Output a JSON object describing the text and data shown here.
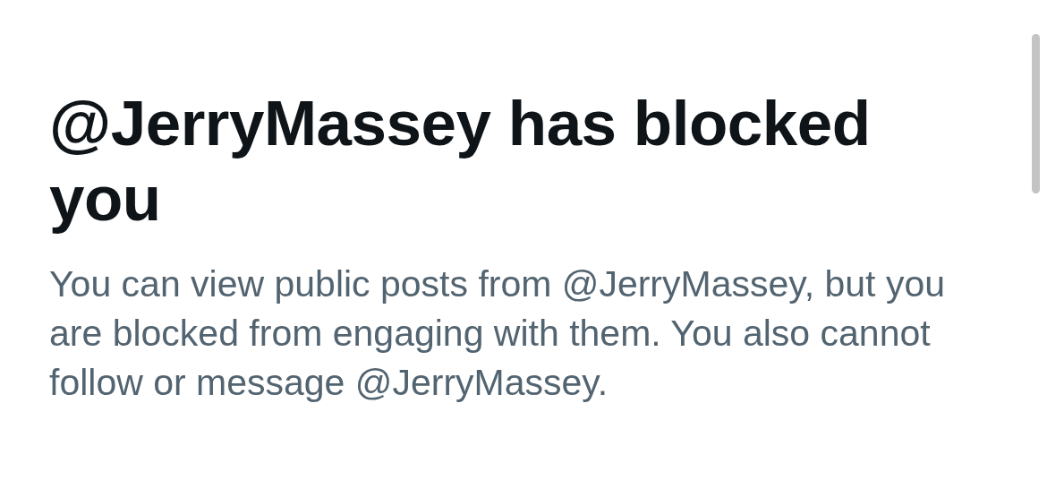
{
  "title": "@JerryMassey has blocked you",
  "message": "You can view public posts from @JerryMassey, but you are blocked from engaging with them. You also cannot follow or message @JerryMassey."
}
